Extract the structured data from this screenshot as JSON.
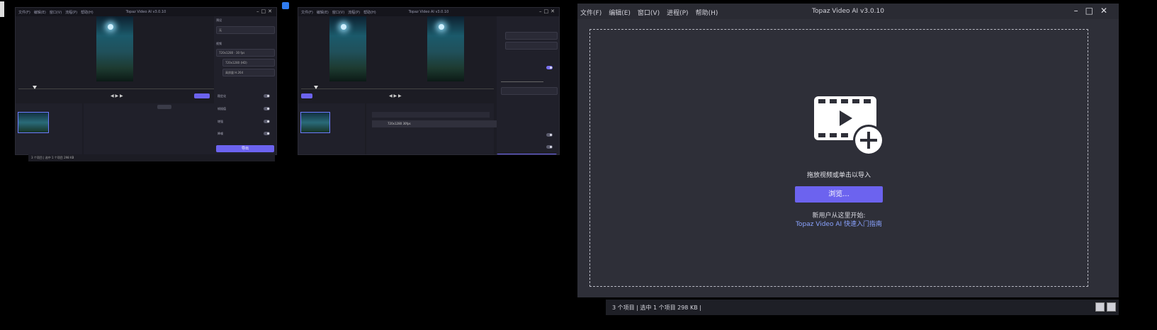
{
  "win1": {
    "menu": [
      "文件(F)",
      "编辑(E)",
      "窗口(V)",
      "流程(P)",
      "帮助(H)"
    ],
    "title": "Topaz Video AI v3.0.10",
    "panel_labels": [
      "预设",
      "无",
      "视频",
      "720x1280 · 30 fps",
      "720x1280 (HD)",
      "高质量 H.264",
      "稳定化",
      "帧插值",
      "增强",
      "降噪"
    ],
    "export_label": "导出",
    "footer": "3 个项目 | 选中 1 个项目 298 KB"
  },
  "win2": {
    "menu": [
      "文件(F)",
      "编辑(E)",
      "窗口(V)",
      "流程(P)",
      "帮助(H)"
    ],
    "title": "Topaz Video AI v3.0.10",
    "item_label": "720x1280 30fps",
    "export_label": "导出"
  },
  "main": {
    "menu": [
      "文件(F)",
      "编辑(E)",
      "窗口(V)",
      "进程(P)",
      "帮助(H)"
    ],
    "title": "Topaz Video AI  v3.0.10",
    "drop_text": "拖放视频或单击以导入",
    "browse_label": "浏览...",
    "new_user": "新用户从这里开始:",
    "guide_link": "Topaz Video AI 快速入门指南"
  },
  "status": {
    "text": "3 个项目  |  选中 1 个项目  298 KB  |"
  },
  "colors": {
    "accent": "#6c63ef",
    "link": "#8aa3ff"
  }
}
